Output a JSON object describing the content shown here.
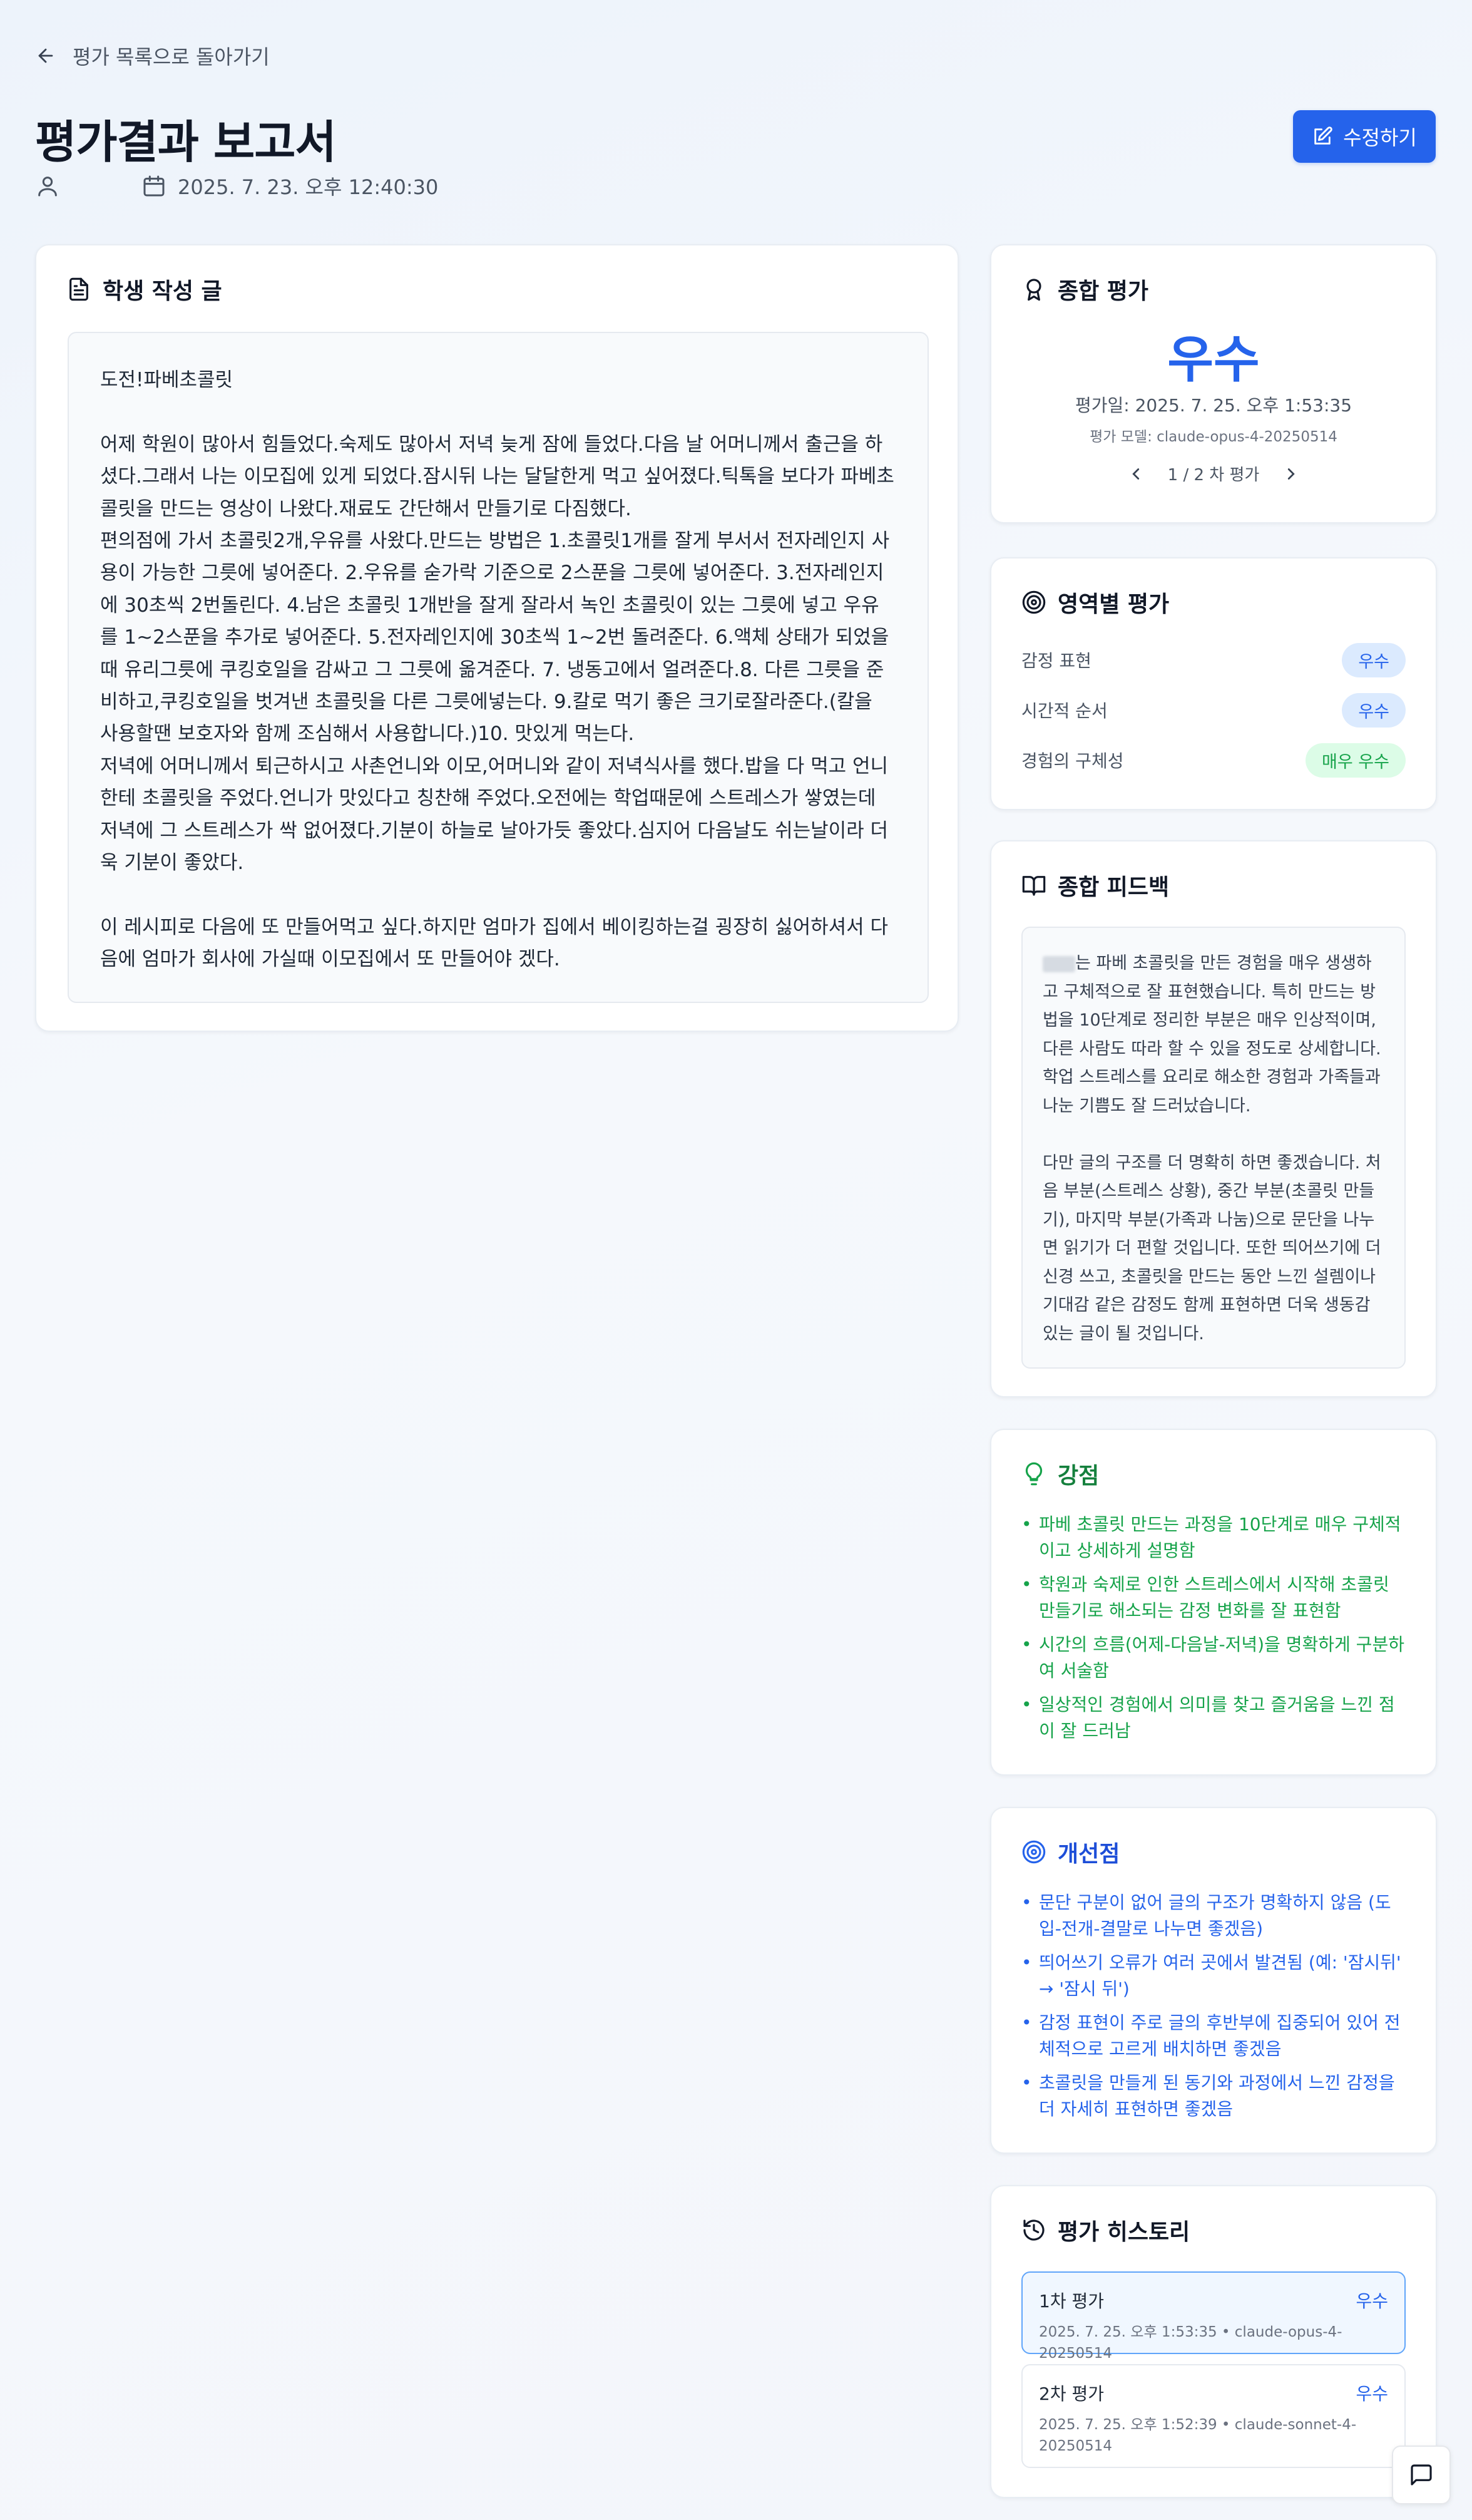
{
  "nav": {
    "back_label": "평가 목록으로 돌아가기"
  },
  "header": {
    "title": "평가결과 보고서",
    "date": "2025. 7. 23. 오후 12:40:30",
    "edit_label": "수정하기"
  },
  "essay": {
    "heading": "학생 작성 글",
    "text": "도전!파베초콜릿\n\n어제 학원이 많아서 힘들었다.숙제도 많아서 저녁 늦게 잠에 들었다.다음 날 어머니께서 출근을 하셨다.그래서 나는 이모집에 있게 되었다.잠시뒤 나는 달달한게 먹고 싶어졌다.틱톡을 보다가 파베초콜릿을 만드는 영상이 나왔다.재료도 간단해서 만들기로 다짐했다.\n편의점에 가서 초콜릿2개,우유를 사왔다.만드는 방법은 1.초콜릿1개를 잘게 부서서 전자레인지 사용이 가능한 그릇에 넣어준다. 2.우유를 숟가락 기준으로 2스푼을 그릇에 넣어준다. 3.전자레인지에 30초씩 2번돌린다. 4.남은 초콜릿 1개반을 잘게 잘라서 녹인 초콜릿이 있는 그릇에 넣고 우유를 1~2스푼을 추가로 넣어준다. 5.전자레인지에 30초씩 1~2번 돌려준다. 6.액체 상태가 되었을때 유리그릇에 쿠킹호일을 감싸고 그 그릇에 옮겨준다. 7. 냉동고에서 얼려준다.8. 다른 그릇을 준비하고,쿠킹호일을 벗겨낸 초콜릿을 다른 그릇에넣는다. 9.칼로 먹기 좋은 크기로잘라준다.(칼을 사용할땐 보호자와 함께 조심해서 사용합니다.)10. 맛있게 먹는다.\n저녁에 어머니께서 퇴근하시고 사촌언니와 이모,어머니와 같이 저녁식사를 했다.밥을 다 먹고 언니한테 초콜릿을 주었다.언니가 맛있다고 칭찬해 주었다.오전에는 학업때문에 스트레스가 쌓였는데 저녁에 그 스트레스가 싹 없어졌다.기분이 하늘로 날아가듯 좋았다.심지어 다음날도 쉬는날이라 더욱 기분이 좋았다.\n\n이 레시피로 다음에 또 만들어먹고 싶다.하지만 엄마가 집에서 베이킹하는걸 굉장히 싫어하셔서 다음에 엄마가 회사에 가실때 이모집에서 또 만들어야 겠다."
  },
  "overall": {
    "heading": "종합 평가",
    "grade": "우수",
    "date": "평가일: 2025. 7. 25. 오후 1:53:35",
    "model": "평가 모델: claude-opus-4-20250514",
    "pager": "1 / 2 차 평가"
  },
  "areas": {
    "heading": "영역별 평가",
    "items": [
      {
        "label": "감정 표현",
        "grade": "우수",
        "color": "#2563eb"
      },
      {
        "label": "시간적 순서",
        "grade": "우수",
        "color": "#2563eb"
      },
      {
        "label": "경험의 구체성",
        "grade": "매우 우수",
        "color": "#16a34a"
      }
    ]
  },
  "feedback": {
    "heading": "종합 피드백",
    "text": "는 파베 초콜릿을 만든 경험을 매우 생생하고 구체적으로 잘 표현했습니다. 특히 만드는 방법을 10단계로 정리한 부분은 매우 인상적이며, 다른 사람도 따라 할 수 있을 정도로 상세합니다. 학업 스트레스를 요리로 해소한 경험과 가족들과 나눈 기쁨도 잘 드러났습니다.\n\n다만 글의 구조를 더 명확히 하면 좋겠습니다. 처음 부분(스트레스 상황), 중간 부분(초콜릿 만들기), 마지막 부분(가족과 나눔)으로 문단을 나누면 읽기가 더 편할 것입니다. 또한 띄어쓰기에 더 신경 쓰고, 초콜릿을 만드는 동안 느낀 설렘이나 기대감 같은 감정도 함께 표현하면 더욱 생동감 있는 글이 될 것입니다."
  },
  "strengths": {
    "heading": "강점",
    "items": [
      "파베 초콜릿 만드는 과정을 10단계로 매우 구체적이고 상세하게 설명함",
      "학원과 숙제로 인한 스트레스에서 시작해 초콜릿 만들기로 해소되는 감정 변화를 잘 표현함",
      "시간의 흐름(어제-다음날-저녁)을 명확하게 구분하여 서술함",
      "일상적인 경험에서 의미를 찾고 즐거움을 느낀 점이 잘 드러남"
    ]
  },
  "improvements": {
    "heading": "개선점",
    "items": [
      "문단 구분이 없어 글의 구조가 명확하지 않음 (도입-전개-결말로 나누면 좋겠음)",
      "띄어쓰기 오류가 여러 곳에서 발견됨 (예: '잠시뒤' → '잠시 뒤')",
      "감정 표현이 주로 글의 후반부에 집중되어 있어 전체적으로 고르게 배치하면 좋겠음",
      "초콜릿을 만들게 된 동기와 과정에서 느낀 감정을 더 자세히 표현하면 좋겠음"
    ]
  },
  "history": {
    "heading": "평가 히스토리",
    "items": [
      {
        "label": "1차 평가",
        "grade": "우수",
        "sub": "2025. 7. 25. 오후 1:53:35  • claude-opus-4-20250514"
      },
      {
        "label": "2차 평가",
        "grade": "우수",
        "sub": "2025. 7. 25. 오후 1:52:39  • claude-sonnet-4-20250514"
      }
    ]
  }
}
